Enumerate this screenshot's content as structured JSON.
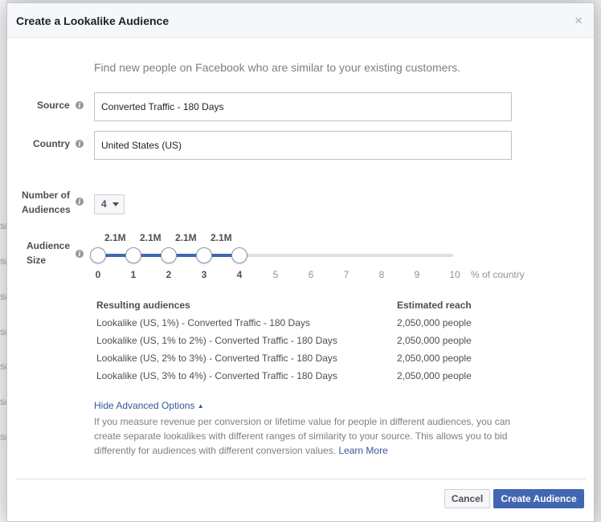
{
  "dialog": {
    "title": "Create a Lookalike Audience",
    "close_glyph": "×",
    "intro": "Find new people on Facebook who are similar to your existing customers."
  },
  "form": {
    "source": {
      "label": "Source",
      "value": "Converted Traffic - 180 Days"
    },
    "country": {
      "label": "Country",
      "value": "United States (US)"
    },
    "number_of_audiences": {
      "label_line1": "Number of",
      "label_line2": "Audiences",
      "value": "4"
    },
    "audience_size": {
      "label_line1": "Audience",
      "label_line2": "Size"
    }
  },
  "slider": {
    "selected_points": [
      0,
      1,
      2,
      3,
      4
    ],
    "reach_labels": [
      "2.1M",
      "2.1M",
      "2.1M",
      "2.1M"
    ],
    "ticks": [
      "0",
      "1",
      "2",
      "3",
      "4",
      "5",
      "6",
      "7",
      "8",
      "9",
      "10"
    ],
    "unit_label": "% of country"
  },
  "results": {
    "header_audiences": "Resulting audiences",
    "header_reach": "Estimated reach",
    "rows": [
      {
        "name": "Lookalike (US, 1%) - Converted Traffic - 180 Days",
        "reach": "2,050,000 people"
      },
      {
        "name": "Lookalike (US, 1% to 2%) - Converted Traffic - 180 Days",
        "reach": "2,050,000 people"
      },
      {
        "name": "Lookalike (US, 2% to 3%) - Converted Traffic - 180 Days",
        "reach": "2,050,000 people"
      },
      {
        "name": "Lookalike (US, 3% to 4%) - Converted Traffic - 180 Days",
        "reach": "2,050,000 people"
      }
    ]
  },
  "advanced": {
    "link": "Hide Advanced Options",
    "text": "If you measure revenue per conversion or lifetime value for people in different audiences, you can create separate lookalikes with different ranges of similarity to your source. This allows you to bid differently for audiences with different conversion values.",
    "learn_more": "Learn More"
  },
  "footer": {
    "cancel": "Cancel",
    "create": "Create Audience"
  },
  "background": {
    "edge_text": [
      "Sig",
      "Sig",
      "Sig",
      "Sig",
      "Sig",
      "Sig",
      "Sig"
    ]
  },
  "colors": {
    "primary": "#4267b2",
    "link": "#365899",
    "header_bg": "#f6f7f9"
  }
}
